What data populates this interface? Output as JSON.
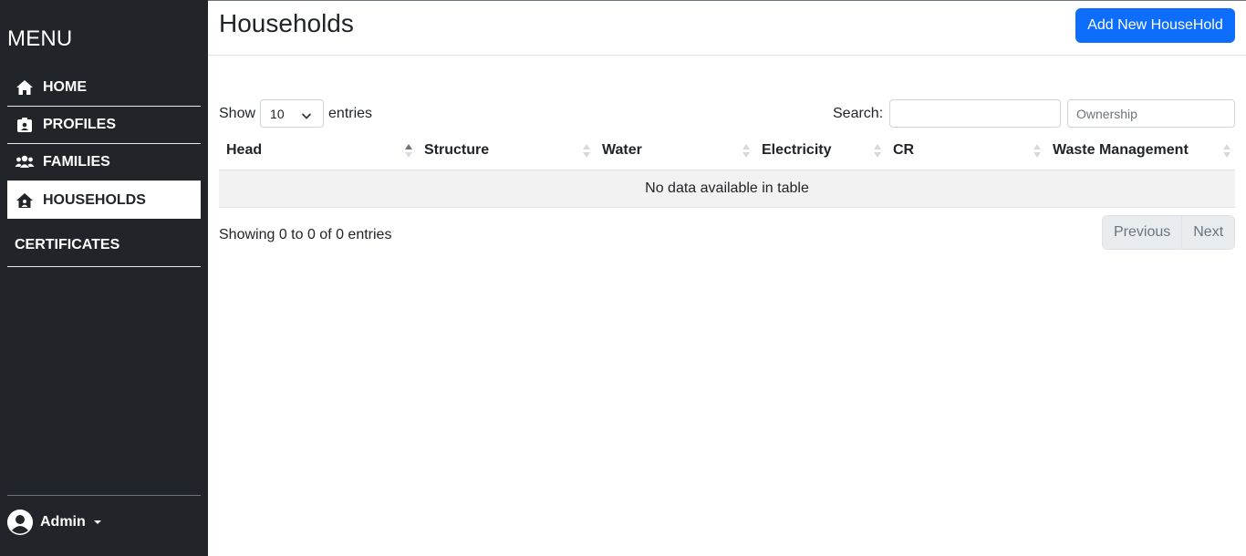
{
  "sidebar": {
    "title": "MENU",
    "items": [
      {
        "label": "HOME",
        "icon": "home-icon"
      },
      {
        "label": "PROFILES",
        "icon": "id-badge-icon"
      },
      {
        "label": "FAMILIES",
        "icon": "users-icon"
      },
      {
        "label": "HOUSEHOLDS",
        "icon": "house-user-icon",
        "active": true
      },
      {
        "label": "CERTIFICATES"
      }
    ],
    "user": {
      "name": "Admin",
      "icon": "user-circle-icon"
    }
  },
  "header": {
    "title": "Households",
    "add_button_label": "Add New HouseHold"
  },
  "table_controls": {
    "show_label": "Show",
    "length_value": "10",
    "entries_label": "entries",
    "search_label": "Search:",
    "search_value": "",
    "ownership_placeholder": "Ownership"
  },
  "table": {
    "columns": [
      "Head",
      "Structure",
      "Water",
      "Electricity",
      "CR",
      "Waste Management"
    ],
    "sorted_column": "Head",
    "empty_message": "No data available in table"
  },
  "footer": {
    "info": "Showing 0 to 0 of 0 entries",
    "prev_label": "Previous",
    "next_label": "Next"
  },
  "colors": {
    "sidebar_bg": "#212529",
    "primary": "#0d6efd",
    "text": "#212529"
  }
}
